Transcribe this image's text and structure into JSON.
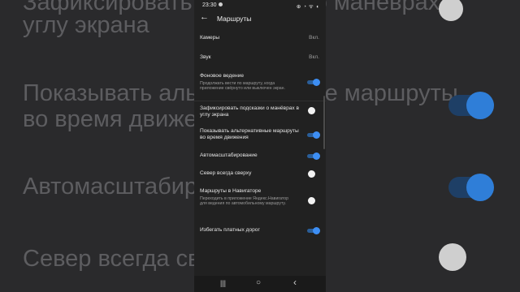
{
  "background": {
    "lines": [
      "Зафиксировать подсказки о манёврах в",
      "углу экрана",
      "Показывать альтернативные маршруты",
      "во время движения",
      "Автомасштабирование",
      "Север всегда сверху"
    ]
  },
  "status_bar": {
    "time": "23:30",
    "icons": "⊕ ◔ ᯤ ◖"
  },
  "app_bar": {
    "back_icon": "←",
    "title": "Маршруты"
  },
  "settings": [
    {
      "label": "Камеры",
      "value": "Вкл."
    },
    {
      "label": "Звук",
      "value": "Вкл."
    },
    {
      "label": "Фоновое ведение",
      "sub": "Продолжать вести по маршруту, когда приложение свёрнуто или выключен экран.",
      "toggle": true
    },
    {
      "label": "Зафиксировать подсказки о манёврах в углу экрана",
      "toggle": false
    },
    {
      "label": "Показывать альтернативные маршруты во время движения",
      "toggle": true
    },
    {
      "label": "Автомасштабирование",
      "toggle": true
    },
    {
      "label": "Север всегда сверху",
      "toggle": false
    },
    {
      "label": "Маршруты в Навигаторе",
      "sub": "Переходить в приложение Яндекс.Навигатор для ведения по автомобильному маршруту.",
      "toggle": false
    },
    {
      "label": "Избегать платных дорог",
      "toggle": true
    }
  ],
  "nav_bar": {
    "recents": "|||",
    "home": "○",
    "back": "‹"
  },
  "colors": {
    "accent": "#3d8ef3",
    "background": "#212121"
  }
}
